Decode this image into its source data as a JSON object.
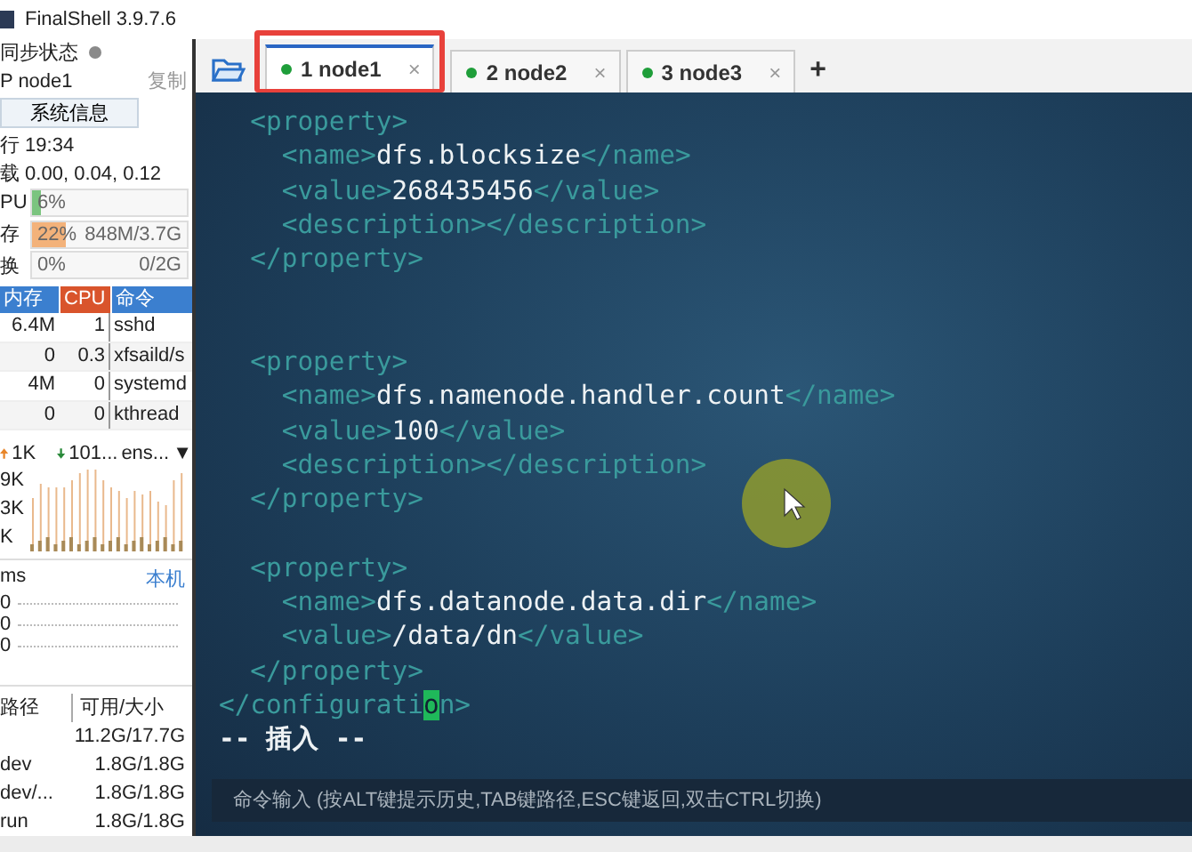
{
  "window": {
    "title": "FinalShell 3.9.7.6"
  },
  "sidebar": {
    "sync": {
      "label": "同步状态",
      "online": false
    },
    "host": {
      "name": "P node1",
      "copy": "复制"
    },
    "sysinfo_button": "系统信息",
    "uptime": "行 19:34",
    "load": "载 0.00, 0.04, 0.12",
    "meters": [
      {
        "label": "PU",
        "kind": "cpu",
        "level": 0.06,
        "reading": "6%"
      },
      {
        "label": "存",
        "kind": "mem",
        "level": 0.22,
        "reading": "22%",
        "detail": "848M/3.7G"
      },
      {
        "label": "换",
        "kind": "swap",
        "level": 0,
        "reading": "0%",
        "detail": "0/2G"
      }
    ],
    "process_table": {
      "columns": [
        {
          "label": "内存",
          "sorted": false
        },
        {
          "label": "CPU",
          "sorted": true
        },
        {
          "label": "命令",
          "sorted": false
        }
      ],
      "rows": [
        [
          "6.4M",
          "1",
          "sshd"
        ],
        [
          "0",
          "0.3",
          "xfsaild/s"
        ],
        [
          "4M",
          "0",
          "systemd"
        ],
        [
          "0",
          "0",
          "kthread"
        ]
      ]
    },
    "network": {
      "up": "1K",
      "down": "101...",
      "interface": "ens...",
      "dropdown": "▼",
      "axis": [
        "9K",
        "3K",
        "K"
      ]
    },
    "ping": {
      "label": "ms",
      "target": "本机",
      "axis": [
        "0",
        "0",
        "0"
      ]
    },
    "disks": {
      "columns": [
        "路径",
        "可用/大小"
      ],
      "rows": [
        {
          "usage": "11.2G/17.7G"
        },
        {
          "path": "dev",
          "usage": "1.8G/1.8G"
        },
        {
          "path": "dev/...",
          "usage": "1.8G/1.8G"
        },
        {
          "path": "run",
          "usage": "1.8G/1.8G"
        }
      ]
    }
  },
  "tabs": [
    {
      "label": "1 node1",
      "close": "×",
      "connected": true,
      "selected": true,
      "highlighted": true
    },
    {
      "label": "2 node2",
      "close": "×",
      "connected": true,
      "selected": false,
      "highlighted": false
    },
    {
      "label": "3 node3",
      "close": "×",
      "connected": true,
      "selected": false,
      "highlighted": false
    }
  ],
  "new_tab": "+",
  "terminal": {
    "lines": [
      {
        "kind": "code",
        "parts": [
          {
            "kind": "tag",
            "text": "  <property>"
          }
        ]
      },
      {
        "kind": "code",
        "parts": [
          {
            "kind": "tag",
            "text": "    <name>"
          },
          {
            "kind": "text",
            "text": "dfs.blocksize"
          },
          {
            "kind": "tag",
            "text": "</name>"
          }
        ]
      },
      {
        "kind": "code",
        "parts": [
          {
            "kind": "tag",
            "text": "    <value>"
          },
          {
            "kind": "text",
            "text": "268435456"
          },
          {
            "kind": "tag",
            "text": "</value>"
          }
        ]
      },
      {
        "kind": "code",
        "parts": [
          {
            "kind": "tag",
            "text": "    <description></description>"
          }
        ]
      },
      {
        "kind": "code",
        "parts": [
          {
            "kind": "tag",
            "text": "  </property>"
          }
        ]
      },
      {
        "kind": "blank"
      },
      {
        "kind": "blank"
      },
      {
        "kind": "code",
        "parts": [
          {
            "kind": "tag",
            "text": "  <property>"
          }
        ]
      },
      {
        "kind": "code",
        "parts": [
          {
            "kind": "tag",
            "text": "    <name>"
          },
          {
            "kind": "text",
            "text": "dfs.namenode.handler.count"
          },
          {
            "kind": "tag",
            "text": "</name>"
          }
        ]
      },
      {
        "kind": "code",
        "parts": [
          {
            "kind": "tag",
            "text": "    <value>"
          },
          {
            "kind": "text",
            "text": "100"
          },
          {
            "kind": "tag",
            "text": "</value>"
          }
        ]
      },
      {
        "kind": "code",
        "parts": [
          {
            "kind": "tag",
            "text": "    <description></description>"
          }
        ]
      },
      {
        "kind": "code",
        "parts": [
          {
            "kind": "tag",
            "text": "  </property>"
          }
        ]
      },
      {
        "kind": "blank"
      },
      {
        "kind": "code",
        "parts": [
          {
            "kind": "tag",
            "text": "  <property>"
          }
        ]
      },
      {
        "kind": "code",
        "parts": [
          {
            "kind": "tag",
            "text": "    <name>"
          },
          {
            "kind": "text",
            "text": "dfs.datanode.data.dir"
          },
          {
            "kind": "tag",
            "text": "</name>"
          }
        ]
      },
      {
        "kind": "code",
        "parts": [
          {
            "kind": "tag",
            "text": "    <value>"
          },
          {
            "kind": "text",
            "text": "/data/dn"
          },
          {
            "kind": "tag",
            "text": "</value>"
          }
        ]
      },
      {
        "kind": "code",
        "parts": [
          {
            "kind": "tag",
            "text": "  </property>"
          }
        ]
      },
      {
        "kind": "code",
        "parts": [
          {
            "kind": "tag",
            "text": "</configurati"
          },
          {
            "kind": "cursor",
            "text": "o"
          },
          {
            "kind": "tag",
            "text": "n>"
          }
        ]
      },
      {
        "kind": "status",
        "parts": [
          {
            "kind": "text",
            "text": "-- 插入 --"
          }
        ]
      }
    ],
    "command_input": {
      "placeholder": "命令输入 (按ALT键提示历史,TAB键路径,ESC键返回,双击CTRL切换)"
    }
  }
}
